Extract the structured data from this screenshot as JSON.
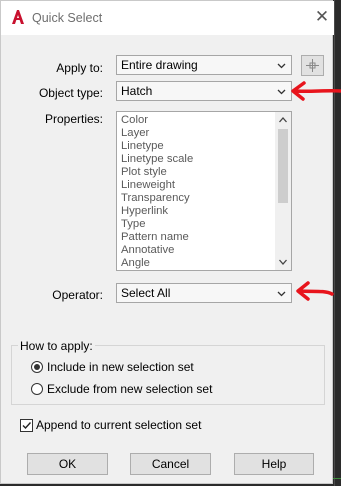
{
  "window": {
    "title": "Quick Select",
    "close_glyph": "✕"
  },
  "form": {
    "apply_to": {
      "label": "Apply to:",
      "value": "Entire drawing"
    },
    "object_type": {
      "label": "Object type:",
      "value": "Hatch"
    },
    "properties": {
      "label": "Properties:",
      "items": [
        "Color",
        "Layer",
        "Linetype",
        "Linetype scale",
        "Plot style",
        "Lineweight",
        "Transparency",
        "Hyperlink",
        "Type",
        "Pattern name",
        "Annotative",
        "Angle"
      ]
    },
    "operator": {
      "label": "Operator:",
      "value": "Select All"
    }
  },
  "how_to_apply": {
    "title": "How to apply:",
    "options": [
      {
        "label": "Include in new selection set",
        "selected": true
      },
      {
        "label": "Exclude from new selection set",
        "selected": false
      }
    ]
  },
  "append": {
    "label": "Append to current selection set",
    "checked": true
  },
  "buttons": {
    "ok": "OK",
    "cancel": "Cancel",
    "help": "Help"
  },
  "colors": {
    "annotation_arrow": "#e8141c",
    "app_logo": "#c8102e"
  },
  "icons": [
    "autocad-logo-icon",
    "close-icon",
    "chevron-down-icon",
    "select-objects-icon",
    "scroll-up-icon",
    "scroll-down-icon"
  ]
}
